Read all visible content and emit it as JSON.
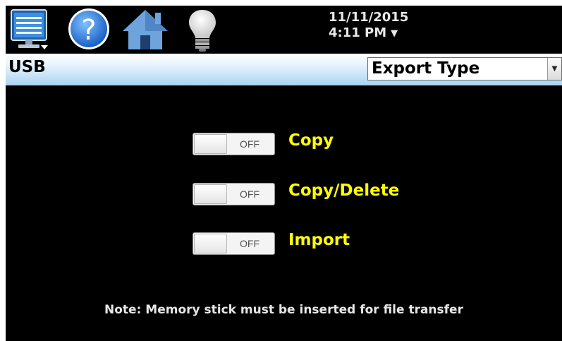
{
  "toolbar": {
    "icons": [
      "monitor-menu-icon",
      "help-icon",
      "home-icon",
      "lightbulb-icon"
    ],
    "date": "11/11/2015",
    "time": "4:11 PM",
    "caret": "▼"
  },
  "header": {
    "title": "USB",
    "export_select": {
      "value": "Export Type"
    }
  },
  "options": [
    {
      "label": "Copy",
      "state": "OFF"
    },
    {
      "label": "Copy/Delete",
      "state": "OFF"
    },
    {
      "label": "Import",
      "state": "OFF"
    }
  ],
  "note": "Note:  Memory stick must be inserted for file transfer",
  "colors": {
    "background": "#000000",
    "option_label": "#ffff00",
    "title_bar_top": "#ffffff",
    "title_bar_bottom": "#a9d3f1"
  }
}
